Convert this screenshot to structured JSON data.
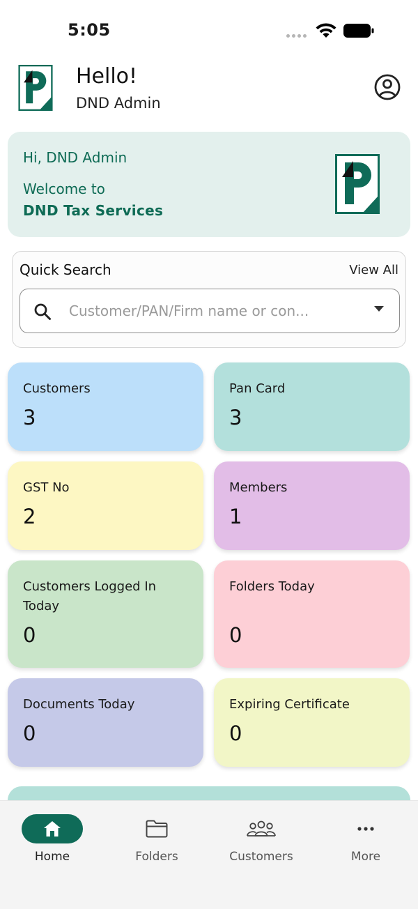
{
  "status_bar": {
    "time": "5:05"
  },
  "header": {
    "greeting": "Hello!",
    "user_name": "DND Admin"
  },
  "welcome": {
    "hi_text": "Hi, DND Admin",
    "welcome_line": "Welcome to",
    "brand": "DND Tax Services"
  },
  "quick_search": {
    "title": "Quick Search",
    "view_all": "View All",
    "placeholder": "Customer/PAN/Firm name or con..."
  },
  "stats": [
    {
      "label": "Customers",
      "value": "3",
      "color": "#bcdffa"
    },
    {
      "label": "Pan Card",
      "value": "3",
      "color": "#b3e0dc"
    },
    {
      "label": "GST No",
      "value": "2",
      "color": "#fdf7c3"
    },
    {
      "label": "Members",
      "value": "1",
      "color": "#e2bde7"
    },
    {
      "label": "Customers Logged In Today",
      "value": "0",
      "color": "#c9e5c9"
    },
    {
      "label": "Folders Today",
      "value": "0",
      "color": "#fdcfd6"
    },
    {
      "label": "Documents Today",
      "value": "0",
      "color": "#c5c9e8"
    },
    {
      "label": "Expiring Certificate",
      "value": "0",
      "color": "#f2f6c7"
    }
  ],
  "nav": [
    {
      "label": "Home",
      "icon": "home-icon",
      "active": true
    },
    {
      "label": "Folders",
      "icon": "folder-icon",
      "active": false
    },
    {
      "label": "Customers",
      "icon": "people-icon",
      "active": false
    },
    {
      "label": "More",
      "icon": "more-dots-icon",
      "active": false
    }
  ],
  "colors": {
    "brand": "#0f6b58",
    "brand_text": "#0e6b55",
    "welcome_bg": "#e3f0ed"
  }
}
